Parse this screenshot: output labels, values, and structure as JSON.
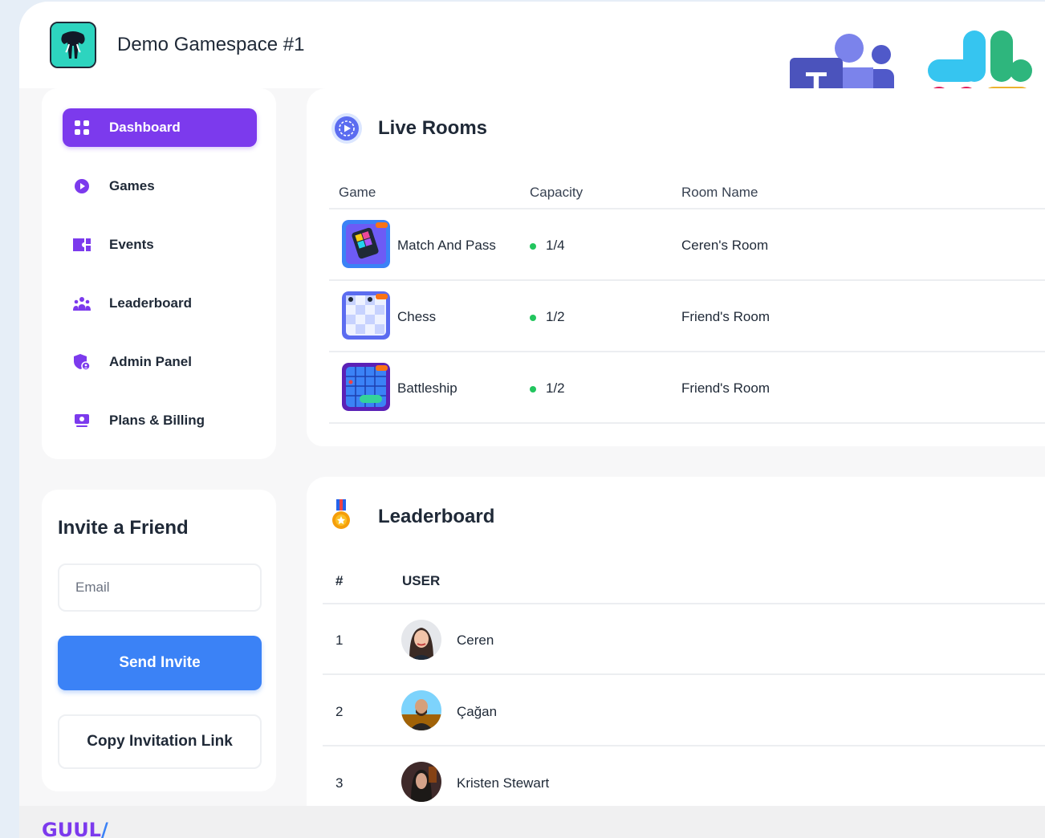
{
  "workspace": {
    "title": "Demo Gamespace #1"
  },
  "brand": {
    "name": "GUUL",
    "slash": "/"
  },
  "sidebar": {
    "items": [
      {
        "label": "Dashboard",
        "icon": "grid-icon",
        "active": true
      },
      {
        "label": "Games",
        "icon": "play-circle-icon"
      },
      {
        "label": "Events",
        "icon": "ticket-icon"
      },
      {
        "label": "Leaderboard",
        "icon": "users-icon"
      },
      {
        "label": "Admin Panel",
        "icon": "shield-user-icon"
      },
      {
        "label": "Plans & Billing",
        "icon": "billing-icon"
      }
    ]
  },
  "invite": {
    "title": "Invite a Friend",
    "email_placeholder": "Email",
    "send_label": "Send Invite",
    "copy_label": "Copy Invitation Link"
  },
  "live_rooms": {
    "title": "Live Rooms",
    "columns": [
      "Game",
      "Capacity",
      "Room Name"
    ],
    "rows": [
      {
        "game": "Match And Pass",
        "capacity": "1/4",
        "room": "Ceren's Room"
      },
      {
        "game": "Chess",
        "capacity": "1/2",
        "room": "Friend's Room"
      },
      {
        "game": "Battleship",
        "capacity": "1/2",
        "room": "Friend's Room"
      }
    ]
  },
  "leaderboard": {
    "title": "Leaderboard",
    "columns": [
      "#",
      "USER"
    ],
    "rows": [
      {
        "rank": "1",
        "name": "Ceren"
      },
      {
        "rank": "2",
        "name": "Çağan"
      },
      {
        "rank": "3",
        "name": "Kristen Stewart"
      }
    ]
  },
  "integrations": [
    "microsoft-teams-logo",
    "slack-logo"
  ],
  "colors": {
    "accent_purple": "#7c3aed",
    "button_blue": "#3b82f6",
    "status_green": "#22c55e",
    "page_background": "#e6eef7"
  }
}
